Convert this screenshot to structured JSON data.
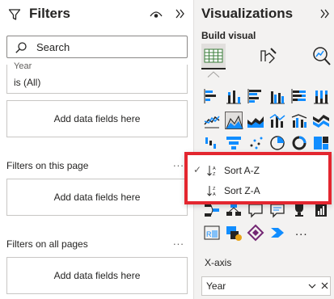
{
  "filters": {
    "title": "Filters",
    "search_placeholder": "Search",
    "year_card": {
      "field": "Year",
      "value": "is (All)"
    },
    "add_fields": "Add data fields here",
    "section_page": "Filters on this page",
    "section_all": "Filters on all pages",
    "more": "..."
  },
  "visualizations": {
    "title": "Visualizations",
    "build_label": "Build visual",
    "more_visuals": "...",
    "xaxis_label": "X-axis",
    "xaxis_field": "Year"
  },
  "sort_menu": {
    "items": [
      {
        "label": "Sort A-Z",
        "checked": true
      },
      {
        "label": "Sort Z-A",
        "checked": false
      }
    ]
  },
  "colors": {
    "highlight_border": "#e3262f",
    "pane_bg": "#f3f2f1",
    "icon_blue": "#118dff",
    "icon_dark": "#252423"
  }
}
